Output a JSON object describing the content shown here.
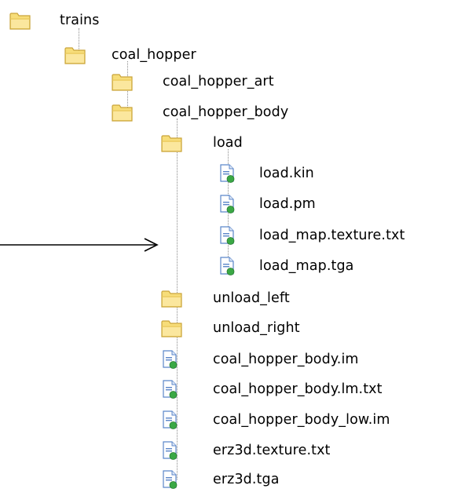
{
  "tree": [
    {
      "label": "trains",
      "icon": "folder",
      "depth": 0,
      "expander": "none",
      "last": true
    },
    {
      "label": "coal_hopper",
      "icon": "folder",
      "depth": 1,
      "expander": "minus",
      "last": true
    },
    {
      "label": "coal_hopper_art",
      "icon": "folder",
      "depth": 2,
      "expander": "plus",
      "last": false
    },
    {
      "label": "coal_hopper_body",
      "icon": "folder",
      "depth": 2,
      "expander": "minus",
      "last": true
    },
    {
      "label": "load",
      "icon": "folder",
      "depth": 3,
      "expander": "minus",
      "last": false
    },
    {
      "label": "load.kin",
      "icon": "file",
      "depth": 4,
      "expander": "none",
      "last": false
    },
    {
      "label": "load.pm",
      "icon": "file",
      "depth": 4,
      "expander": "none",
      "last": false
    },
    {
      "label": "load_map.texture.txt",
      "icon": "file",
      "depth": 4,
      "expander": "none",
      "last": false
    },
    {
      "label": "load_map.tga",
      "icon": "file",
      "depth": 4,
      "expander": "none",
      "last": true
    },
    {
      "label": "unload_left",
      "icon": "folder",
      "depth": 3,
      "expander": "plus",
      "last": false
    },
    {
      "label": "unload_right",
      "icon": "folder",
      "depth": 3,
      "expander": "plus",
      "last": false
    },
    {
      "label": "coal_hopper_body.im",
      "icon": "file",
      "depth": 3,
      "expander": "none",
      "last": false
    },
    {
      "label": "coal_hopper_body.lm.txt",
      "icon": "file",
      "depth": 3,
      "expander": "none",
      "last": false
    },
    {
      "label": "coal_hopper_body_low.im",
      "icon": "file",
      "depth": 3,
      "expander": "none",
      "last": false
    },
    {
      "label": "erz3d.texture.txt",
      "icon": "file",
      "depth": 3,
      "expander": "none",
      "last": false
    },
    {
      "label": "erz3d.tga",
      "icon": "file",
      "depth": 3,
      "expander": "none",
      "last": true
    }
  ],
  "annotation": {
    "target": "load_map.texture.txt",
    "icon": "arrow-right-icon"
  },
  "colors": {
    "folder_fill": "#f7dd79",
    "folder_edge": "#c9a43a",
    "file_fill": "#ffffff",
    "file_edge": "#5b86c9",
    "file_accent": "#3aa845",
    "tree_line": "#8c8c8c"
  }
}
